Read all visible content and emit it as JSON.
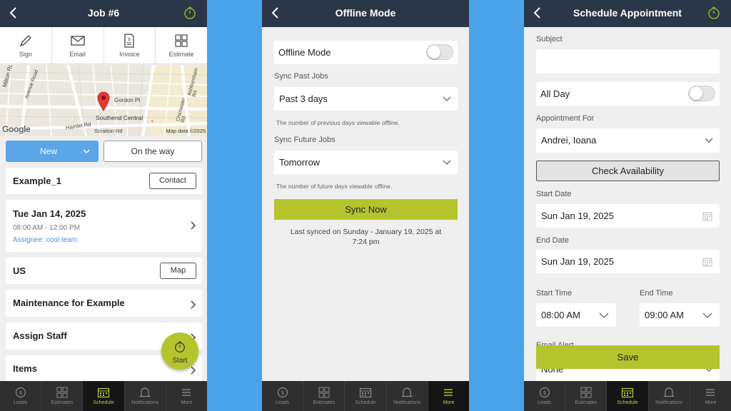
{
  "screen1": {
    "title": "Job #6",
    "actions": [
      {
        "label": "Sign",
        "icon": "pen-icon"
      },
      {
        "label": "Email",
        "icon": "envelope-icon"
      },
      {
        "label": "Invoice",
        "icon": "invoice-icon"
      },
      {
        "label": "Estimate",
        "icon": "calculator-icon"
      }
    ],
    "map": {
      "streets": [
        "Milton Rd",
        "Avenue Road",
        "Gordon Pl",
        "Southend Central",
        "Chichester Rd",
        "Hamlet Rd",
        "Scratton Rd",
        "Ashburnham Rd"
      ],
      "google": "Google",
      "attribution": "Map data ©2025"
    },
    "status_select": "New",
    "on_the_way": "On the way",
    "customer": "Example_1",
    "contact_btn": "Contact",
    "date": "Tue Jan 14, 2025",
    "time": "08:00 AM - 12:00 PM",
    "assignee": "Assignee: cool team",
    "location": "US",
    "map_btn": "Map",
    "description": "Maintenance for Example",
    "assign_staff": "Assign Staff",
    "items": "Items",
    "start_btn": "Start"
  },
  "screen2": {
    "title": "Offline Mode",
    "offline_label": "Offline Mode",
    "offline_on": false,
    "sync_past_label": "Sync Past Jobs",
    "sync_past_value": "Past 3 days",
    "sync_past_hint": "The number of previous days viewable offline.",
    "sync_future_label": "Sync Future Jobs",
    "sync_future_value": "Tomorrow",
    "sync_future_hint": "The number of future days viewable offline.",
    "sync_now": "Sync Now",
    "last_synced_1": "Last synced on Sunday - January 19, 2025 at",
    "last_synced_2": "7:24 pm"
  },
  "screen3": {
    "title": "Schedule Appointment",
    "subject_label": "Subject",
    "subject_value": "",
    "all_day": "All Day",
    "all_day_on": false,
    "appt_for_label": "Appointment For",
    "appt_for_value": "Andrei, Ioana",
    "check_availability": "Check Availability",
    "start_date_label": "Start Date",
    "start_date": "Sun Jan 19, 2025",
    "end_date_label": "End Date",
    "end_date": "Sun Jan 19, 2025",
    "start_time_label": "Start Time",
    "start_time": "08:00 AM",
    "end_time_label": "End Time",
    "end_time": "09:00 AM",
    "email_alert_label": "Email Alert",
    "email_alert_value": "None",
    "save": "Save"
  },
  "nav": [
    {
      "label": "Leads",
      "icon": "dollar-icon"
    },
    {
      "label": "Estimates",
      "icon": "grid-icon"
    },
    {
      "label": "Schedule",
      "icon": "calendar-icon"
    },
    {
      "label": "Notifications",
      "icon": "bell-icon"
    },
    {
      "label": "More",
      "icon": "menu-icon"
    }
  ],
  "colors": {
    "header": "#2b3748",
    "accent_green": "#b4c42d",
    "primary_blue": "#5aa6e6",
    "link_blue": "#4a90d9",
    "pin_red": "#e53935",
    "backdrop": "#4aa3e8"
  }
}
